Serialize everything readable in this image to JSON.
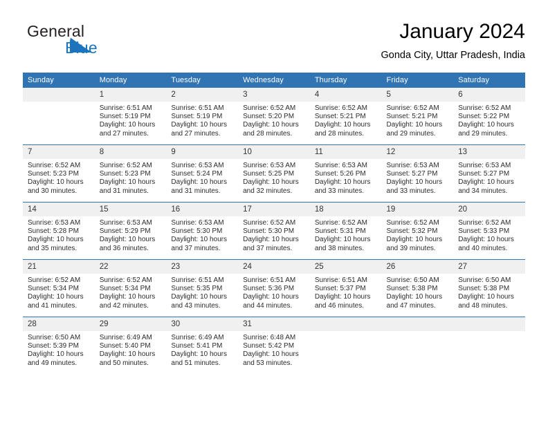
{
  "brand": {
    "word1": "General",
    "word2": "Blue",
    "accent_color": "#1c75bc"
  },
  "header": {
    "title": "January 2024",
    "location": "Gonda City, Uttar Pradesh, India"
  },
  "theme": {
    "header_blue": "#3174b4",
    "daynum_band": "#f0f0f0",
    "text": "#000000"
  },
  "weekday_headers": [
    "Sunday",
    "Monday",
    "Tuesday",
    "Wednesday",
    "Thursday",
    "Friday",
    "Saturday"
  ],
  "weeks": [
    [
      {
        "day": "",
        "sunrise": "",
        "sunset": "",
        "daylight_line1": "",
        "daylight_line2": "",
        "empty": true
      },
      {
        "day": "1",
        "sunrise": "Sunrise: 6:51 AM",
        "sunset": "Sunset: 5:19 PM",
        "daylight_line1": "Daylight: 10 hours",
        "daylight_line2": "and 27 minutes."
      },
      {
        "day": "2",
        "sunrise": "Sunrise: 6:51 AM",
        "sunset": "Sunset: 5:19 PM",
        "daylight_line1": "Daylight: 10 hours",
        "daylight_line2": "and 27 minutes."
      },
      {
        "day": "3",
        "sunrise": "Sunrise: 6:52 AM",
        "sunset": "Sunset: 5:20 PM",
        "daylight_line1": "Daylight: 10 hours",
        "daylight_line2": "and 28 minutes."
      },
      {
        "day": "4",
        "sunrise": "Sunrise: 6:52 AM",
        "sunset": "Sunset: 5:21 PM",
        "daylight_line1": "Daylight: 10 hours",
        "daylight_line2": "and 28 minutes."
      },
      {
        "day": "5",
        "sunrise": "Sunrise: 6:52 AM",
        "sunset": "Sunset: 5:21 PM",
        "daylight_line1": "Daylight: 10 hours",
        "daylight_line2": "and 29 minutes."
      },
      {
        "day": "6",
        "sunrise": "Sunrise: 6:52 AM",
        "sunset": "Sunset: 5:22 PM",
        "daylight_line1": "Daylight: 10 hours",
        "daylight_line2": "and 29 minutes."
      }
    ],
    [
      {
        "day": "7",
        "sunrise": "Sunrise: 6:52 AM",
        "sunset": "Sunset: 5:23 PM",
        "daylight_line1": "Daylight: 10 hours",
        "daylight_line2": "and 30 minutes."
      },
      {
        "day": "8",
        "sunrise": "Sunrise: 6:52 AM",
        "sunset": "Sunset: 5:23 PM",
        "daylight_line1": "Daylight: 10 hours",
        "daylight_line2": "and 31 minutes."
      },
      {
        "day": "9",
        "sunrise": "Sunrise: 6:53 AM",
        "sunset": "Sunset: 5:24 PM",
        "daylight_line1": "Daylight: 10 hours",
        "daylight_line2": "and 31 minutes."
      },
      {
        "day": "10",
        "sunrise": "Sunrise: 6:53 AM",
        "sunset": "Sunset: 5:25 PM",
        "daylight_line1": "Daylight: 10 hours",
        "daylight_line2": "and 32 minutes."
      },
      {
        "day": "11",
        "sunrise": "Sunrise: 6:53 AM",
        "sunset": "Sunset: 5:26 PM",
        "daylight_line1": "Daylight: 10 hours",
        "daylight_line2": "and 33 minutes."
      },
      {
        "day": "12",
        "sunrise": "Sunrise: 6:53 AM",
        "sunset": "Sunset: 5:27 PM",
        "daylight_line1": "Daylight: 10 hours",
        "daylight_line2": "and 33 minutes."
      },
      {
        "day": "13",
        "sunrise": "Sunrise: 6:53 AM",
        "sunset": "Sunset: 5:27 PM",
        "daylight_line1": "Daylight: 10 hours",
        "daylight_line2": "and 34 minutes."
      }
    ],
    [
      {
        "day": "14",
        "sunrise": "Sunrise: 6:53 AM",
        "sunset": "Sunset: 5:28 PM",
        "daylight_line1": "Daylight: 10 hours",
        "daylight_line2": "and 35 minutes."
      },
      {
        "day": "15",
        "sunrise": "Sunrise: 6:53 AM",
        "sunset": "Sunset: 5:29 PM",
        "daylight_line1": "Daylight: 10 hours",
        "daylight_line2": "and 36 minutes."
      },
      {
        "day": "16",
        "sunrise": "Sunrise: 6:53 AM",
        "sunset": "Sunset: 5:30 PM",
        "daylight_line1": "Daylight: 10 hours",
        "daylight_line2": "and 37 minutes."
      },
      {
        "day": "17",
        "sunrise": "Sunrise: 6:52 AM",
        "sunset": "Sunset: 5:30 PM",
        "daylight_line1": "Daylight: 10 hours",
        "daylight_line2": "and 37 minutes."
      },
      {
        "day": "18",
        "sunrise": "Sunrise: 6:52 AM",
        "sunset": "Sunset: 5:31 PM",
        "daylight_line1": "Daylight: 10 hours",
        "daylight_line2": "and 38 minutes."
      },
      {
        "day": "19",
        "sunrise": "Sunrise: 6:52 AM",
        "sunset": "Sunset: 5:32 PM",
        "daylight_line1": "Daylight: 10 hours",
        "daylight_line2": "and 39 minutes."
      },
      {
        "day": "20",
        "sunrise": "Sunrise: 6:52 AM",
        "sunset": "Sunset: 5:33 PM",
        "daylight_line1": "Daylight: 10 hours",
        "daylight_line2": "and 40 minutes."
      }
    ],
    [
      {
        "day": "21",
        "sunrise": "Sunrise: 6:52 AM",
        "sunset": "Sunset: 5:34 PM",
        "daylight_line1": "Daylight: 10 hours",
        "daylight_line2": "and 41 minutes."
      },
      {
        "day": "22",
        "sunrise": "Sunrise: 6:52 AM",
        "sunset": "Sunset: 5:34 PM",
        "daylight_line1": "Daylight: 10 hours",
        "daylight_line2": "and 42 minutes."
      },
      {
        "day": "23",
        "sunrise": "Sunrise: 6:51 AM",
        "sunset": "Sunset: 5:35 PM",
        "daylight_line1": "Daylight: 10 hours",
        "daylight_line2": "and 43 minutes."
      },
      {
        "day": "24",
        "sunrise": "Sunrise: 6:51 AM",
        "sunset": "Sunset: 5:36 PM",
        "daylight_line1": "Daylight: 10 hours",
        "daylight_line2": "and 44 minutes."
      },
      {
        "day": "25",
        "sunrise": "Sunrise: 6:51 AM",
        "sunset": "Sunset: 5:37 PM",
        "daylight_line1": "Daylight: 10 hours",
        "daylight_line2": "and 46 minutes."
      },
      {
        "day": "26",
        "sunrise": "Sunrise: 6:50 AM",
        "sunset": "Sunset: 5:38 PM",
        "daylight_line1": "Daylight: 10 hours",
        "daylight_line2": "and 47 minutes."
      },
      {
        "day": "27",
        "sunrise": "Sunrise: 6:50 AM",
        "sunset": "Sunset: 5:38 PM",
        "daylight_line1": "Daylight: 10 hours",
        "daylight_line2": "and 48 minutes."
      }
    ],
    [
      {
        "day": "28",
        "sunrise": "Sunrise: 6:50 AM",
        "sunset": "Sunset: 5:39 PM",
        "daylight_line1": "Daylight: 10 hours",
        "daylight_line2": "and 49 minutes."
      },
      {
        "day": "29",
        "sunrise": "Sunrise: 6:49 AM",
        "sunset": "Sunset: 5:40 PM",
        "daylight_line1": "Daylight: 10 hours",
        "daylight_line2": "and 50 minutes."
      },
      {
        "day": "30",
        "sunrise": "Sunrise: 6:49 AM",
        "sunset": "Sunset: 5:41 PM",
        "daylight_line1": "Daylight: 10 hours",
        "daylight_line2": "and 51 minutes."
      },
      {
        "day": "31",
        "sunrise": "Sunrise: 6:48 AM",
        "sunset": "Sunset: 5:42 PM",
        "daylight_line1": "Daylight: 10 hours",
        "daylight_line2": "and 53 minutes."
      },
      {
        "day": "",
        "sunrise": "",
        "sunset": "",
        "daylight_line1": "",
        "daylight_line2": "",
        "empty": true
      },
      {
        "day": "",
        "sunrise": "",
        "sunset": "",
        "daylight_line1": "",
        "daylight_line2": "",
        "empty": true
      },
      {
        "day": "",
        "sunrise": "",
        "sunset": "",
        "daylight_line1": "",
        "daylight_line2": "",
        "empty": true
      }
    ]
  ]
}
